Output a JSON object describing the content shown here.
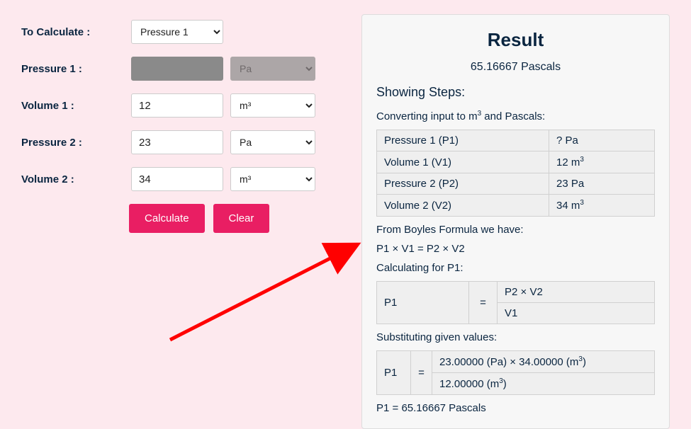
{
  "form": {
    "toCalculateLabel": "To Calculate :",
    "toCalculateValue": "Pressure 1",
    "fields": [
      {
        "label": "Pressure 1 :",
        "value": "",
        "unit": "Pa",
        "disabled": true
      },
      {
        "label": "Volume 1 :",
        "value": "12",
        "unit": "m³",
        "disabled": false
      },
      {
        "label": "Pressure 2 :",
        "value": "23",
        "unit": "Pa",
        "disabled": false
      },
      {
        "label": "Volume 2 :",
        "value": "34",
        "unit": "m³",
        "disabled": false
      }
    ],
    "calcBtn": "Calculate",
    "clearBtn": "Clear"
  },
  "result": {
    "title": "Result",
    "value": "65.16667 Pascals",
    "stepsHeading": "Showing Steps:",
    "convIntro": "Converting input to m",
    "convIntroRest": " and Pascals:",
    "convTable": [
      {
        "name": "Pressure 1 (P1)",
        "val": "? Pa"
      },
      {
        "name": "Volume 1 (V1)",
        "val": "12 m",
        "sup": "3"
      },
      {
        "name": "Pressure 2 (P2)",
        "val": "23 Pa"
      },
      {
        "name": "Volume 2 (V2)",
        "val": "34 m",
        "sup": "3"
      }
    ],
    "boyleText": "From Boyles Formula we have:",
    "boyleFormula": "P1 × V1 = P2 × V2",
    "calcFor": "Calculating for P1:",
    "frac1": {
      "left": "P1",
      "eq": "=",
      "top": "P2 × V2",
      "bot": "V1"
    },
    "subText": "Substituting given values:",
    "frac2": {
      "left": "P1",
      "eq": "=",
      "top": "23.00000 (Pa) × 34.00000 (m",
      "bot": "12.00000 (m",
      "sup": "3",
      "topClose": ")",
      "botClose": ")"
    },
    "finalLine": "P1 = 65.16667 Pascals"
  }
}
